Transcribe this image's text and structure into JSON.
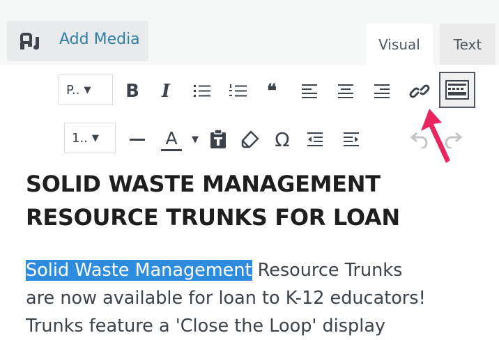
{
  "media": {
    "add_media_label": "Add Media"
  },
  "tabs": {
    "visual": "Visual",
    "text": "Text"
  },
  "toolbar": {
    "paragraph_select": "P..",
    "fontsize_select": "1..",
    "bold": "B",
    "italic": "I",
    "blockquote": "66",
    "text_color": "A",
    "special_char": "Ω"
  },
  "content": {
    "heading_line1": "SOLID WASTE MANAGEMENT",
    "heading_line2": "RESOURCE TRUNKS FOR LOAN",
    "selected_text": "Solid Waste Management",
    "body_after_selection": " Resource Trunks",
    "body_line2": "are now available for loan to K-12 educators!",
    "body_line3": "Trunks feature a 'Close the Loop' display"
  },
  "colors": {
    "link": "#2f7ea5",
    "selection": "#2e8cde",
    "pointer": "#e8265e"
  }
}
